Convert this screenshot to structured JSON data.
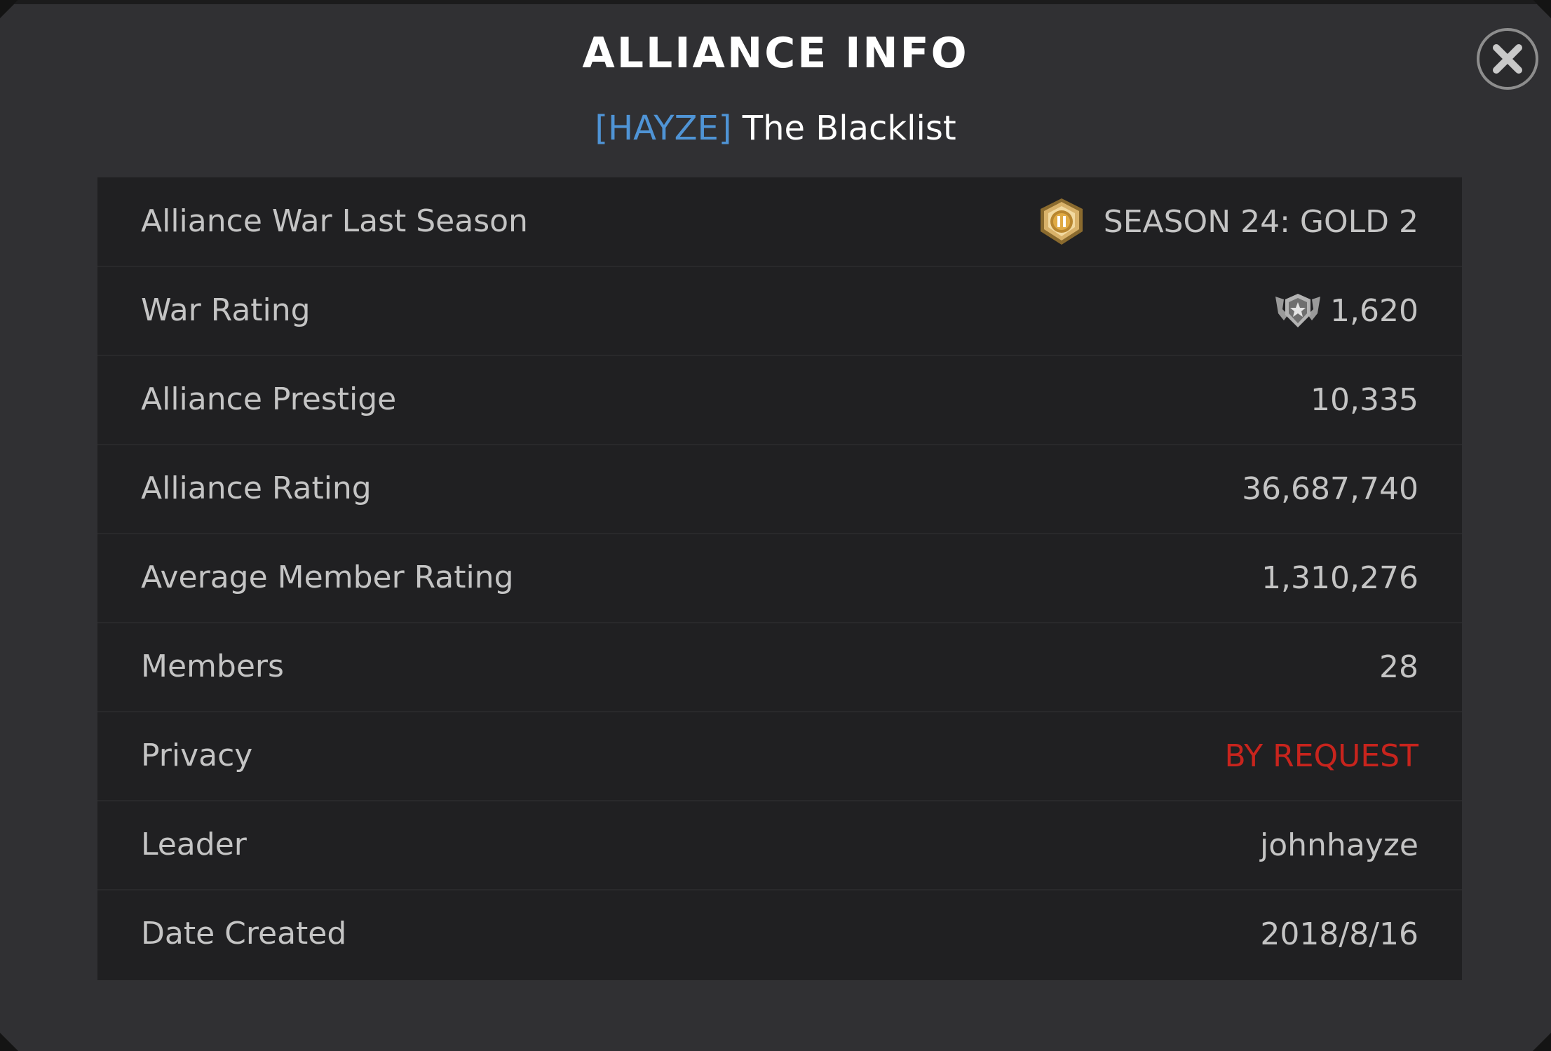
{
  "header": {
    "title": "ALLIANCE INFO",
    "alliance_tag": "[HAYZE]",
    "alliance_name": "The Blacklist",
    "close_icon": "close-x-icon"
  },
  "rows": [
    {
      "label": "Alliance War Last Season",
      "value": "SEASON 24: GOLD 2",
      "icon": "gold-2-badge-icon"
    },
    {
      "label": "War Rating",
      "value": "1,620",
      "icon": "war-rating-shield-icon"
    },
    {
      "label": "Alliance Prestige",
      "value": "10,335"
    },
    {
      "label": "Alliance Rating",
      "value": "36,687,740"
    },
    {
      "label": "Average Member Rating",
      "value": "1,310,276"
    },
    {
      "label": "Members",
      "value": "28"
    },
    {
      "label": "Privacy",
      "value": "BY REQUEST",
      "color": "#c8241d"
    },
    {
      "label": "Leader",
      "value": "johnhayze"
    },
    {
      "label": "Date Created",
      "value": "2018/8/16"
    }
  ]
}
